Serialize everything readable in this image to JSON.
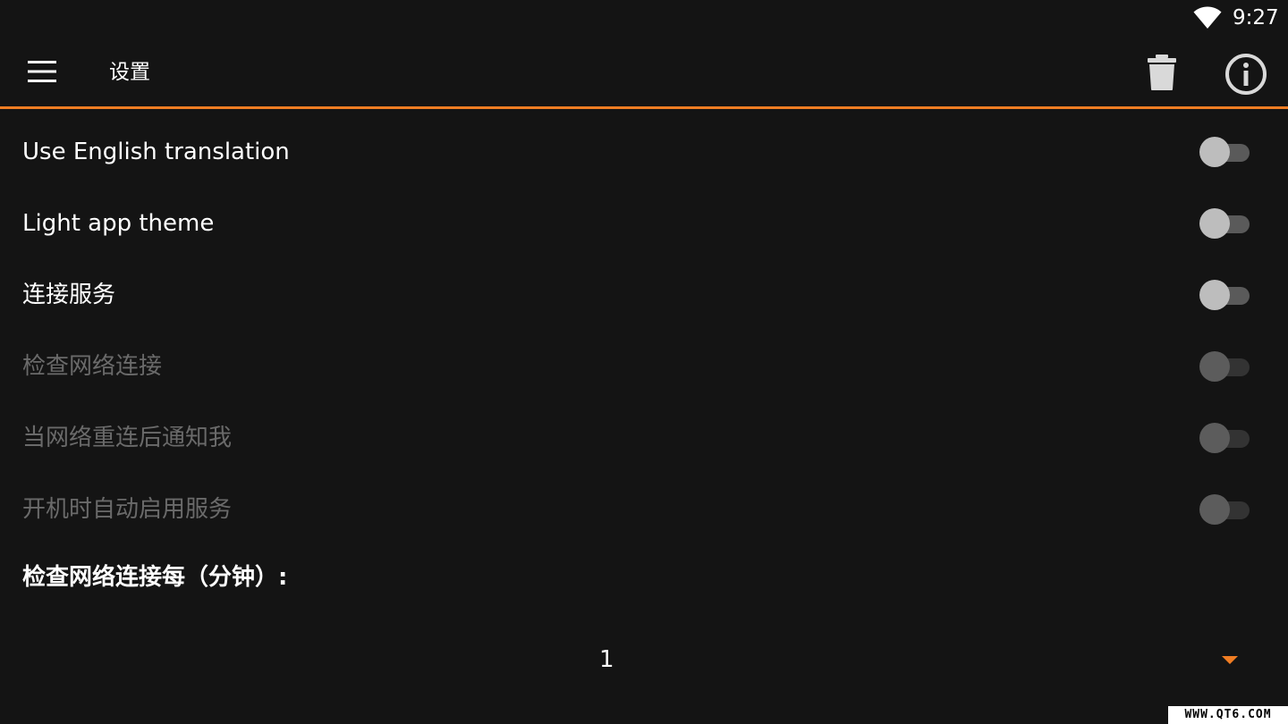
{
  "status_bar": {
    "time": "9:27",
    "wifi_icon": "wifi-icon"
  },
  "toolbar": {
    "title": "设置",
    "menu_icon": "hamburger-menu-icon",
    "delete_icon": "trash-icon",
    "info_icon": "info-icon"
  },
  "colors": {
    "accent": "#f07d23",
    "background": "#141414",
    "disabled_text": "#6a6a6a"
  },
  "settings": [
    {
      "label": "Use English translation",
      "enabled": true,
      "checked": false
    },
    {
      "label": "Light app theme",
      "enabled": true,
      "checked": false
    },
    {
      "label": "连接服务",
      "enabled": true,
      "checked": false
    },
    {
      "label": "检查网络连接",
      "enabled": false,
      "checked": false
    },
    {
      "label": "当网络重连后通知我",
      "enabled": false,
      "checked": false
    },
    {
      "label": "开机时自动启用服务",
      "enabled": false,
      "checked": false
    }
  ],
  "interval": {
    "label": "检查网络连接每（分钟）:",
    "value": "1"
  },
  "watermark": "WWW.QT6.COM"
}
